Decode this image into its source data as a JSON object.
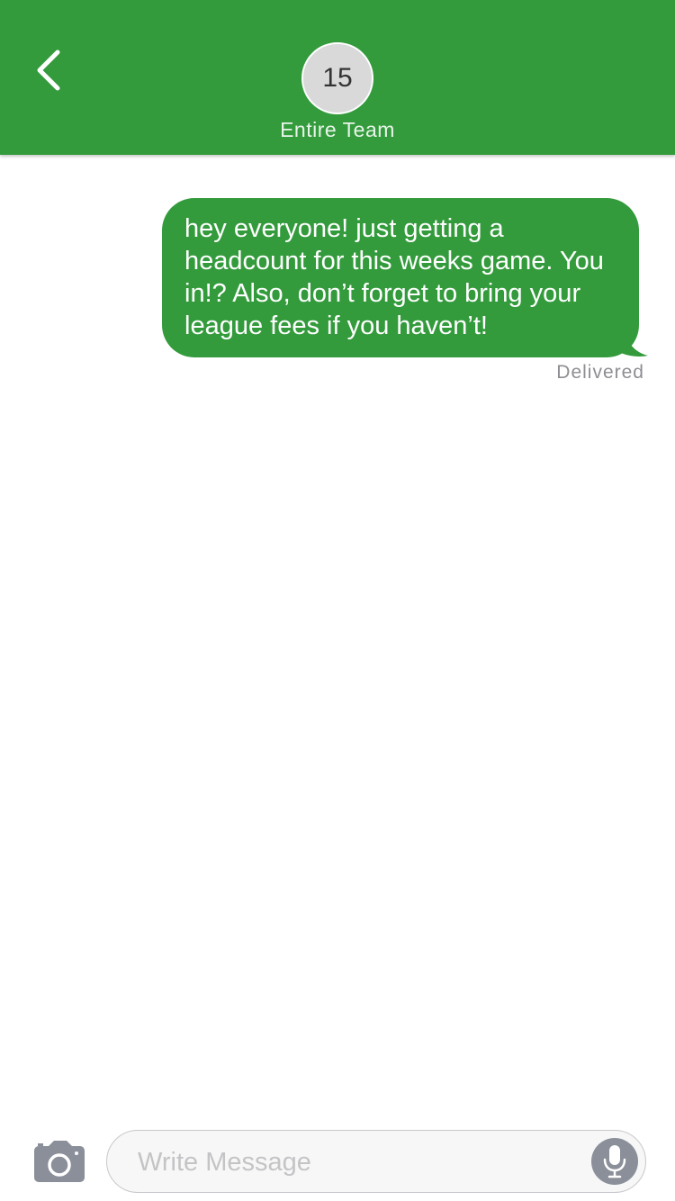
{
  "header": {
    "back_icon": "chevron-left-icon",
    "avatar_count": "15",
    "group_name": "Entire Team"
  },
  "messages": [
    {
      "direction": "outgoing",
      "text": "hey everyone! just getting a headcount for this weeks game. You in!? Also, don’t forget to bring your league fees if you haven’t!",
      "status": "Delivered"
    }
  ],
  "composer": {
    "camera_icon": "camera-icon",
    "placeholder": "Write Message",
    "value": "",
    "mic_icon": "microphone-icon"
  },
  "colors": {
    "brand_green": "#339b3c",
    "bubble_text": "#ffffff",
    "status_gray": "#8e8e93",
    "icon_gray": "#8a8f99"
  }
}
